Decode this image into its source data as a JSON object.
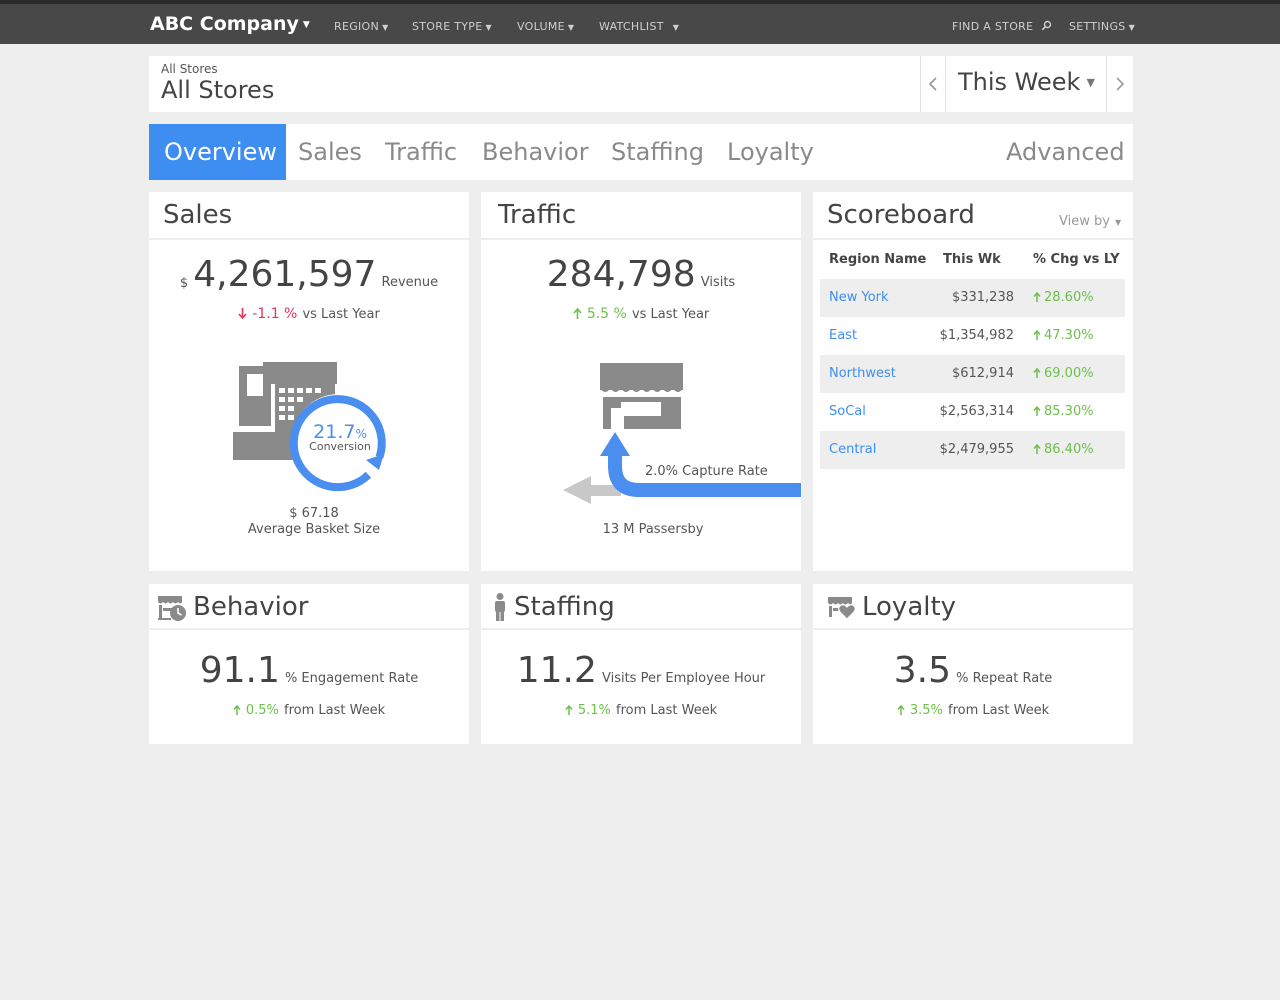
{
  "nav": {
    "brand": "ABC Company",
    "menu": [
      "REGION",
      "STORE TYPE",
      "VOLUME",
      "WATCHLIST"
    ],
    "find_store": "FIND A STORE",
    "settings": "SETTINGS"
  },
  "header": {
    "breadcrumb": "All Stores",
    "title": "All Stores",
    "period": "This Week"
  },
  "tabs": [
    "Overview",
    "Sales",
    "Traffic",
    "Behavior",
    "Staffing",
    "Loyalty",
    "Advanced"
  ],
  "sales": {
    "title": "Sales",
    "currency": "$",
    "revenue": "4,261,597",
    "revenue_label": "Revenue",
    "change": "-1.1 %",
    "change_label": "vs Last Year",
    "conversion_value": "21.7",
    "conversion_unit": "%",
    "conversion_label": "Conversion",
    "basket_value": "$ 67.18",
    "basket_label": "Average Basket Size"
  },
  "traffic": {
    "title": "Traffic",
    "visits": "284,798",
    "visits_label": "Visits",
    "change": "5.5 %",
    "change_label": "vs Last Year",
    "capture_rate": "2.0% Capture Rate",
    "passersby": "13 M Passersby"
  },
  "scoreboard": {
    "title": "Scoreboard",
    "view_by": "View by",
    "columns": [
      "Region Name",
      "This Wk",
      "% Chg vs LY"
    ],
    "rows": [
      {
        "region": "New York",
        "value": "$331,238",
        "change": "28.60%"
      },
      {
        "region": "East",
        "value": "$1,354,982",
        "change": "47.30%"
      },
      {
        "region": "Northwest",
        "value": "$612,914",
        "change": "69.00%"
      },
      {
        "region": "SoCal",
        "value": "$2,563,314",
        "change": "85.30%"
      },
      {
        "region": "Central",
        "value": "$2,479,955",
        "change": "86.40%"
      }
    ]
  },
  "behavior": {
    "title": "Behavior",
    "value": "91.1",
    "label": "% Engagement Rate",
    "change": "0.5%",
    "change_label": "from Last Week"
  },
  "staffing": {
    "title": "Staffing",
    "value": "11.2",
    "label": "Visits Per Employee Hour",
    "change": "5.1%",
    "change_label": "from Last Week"
  },
  "loyalty": {
    "title": "Loyalty",
    "value": "3.5",
    "label": "% Repeat Rate",
    "change": "3.5%",
    "change_label": "from Last Week"
  },
  "colors": {
    "accent": "#3e8ef2",
    "positive": "#6cc04a",
    "negative": "#e0365a",
    "topbar": "#484848",
    "icon_gray": "#8a8a8a"
  },
  "icons": [
    "search-icon",
    "chevron-left-icon",
    "chevron-right-icon",
    "cash-register-icon",
    "store-icon",
    "clock-store-icon",
    "person-icon",
    "heart-store-icon",
    "arrow-up-icon",
    "arrow-down-icon"
  ]
}
